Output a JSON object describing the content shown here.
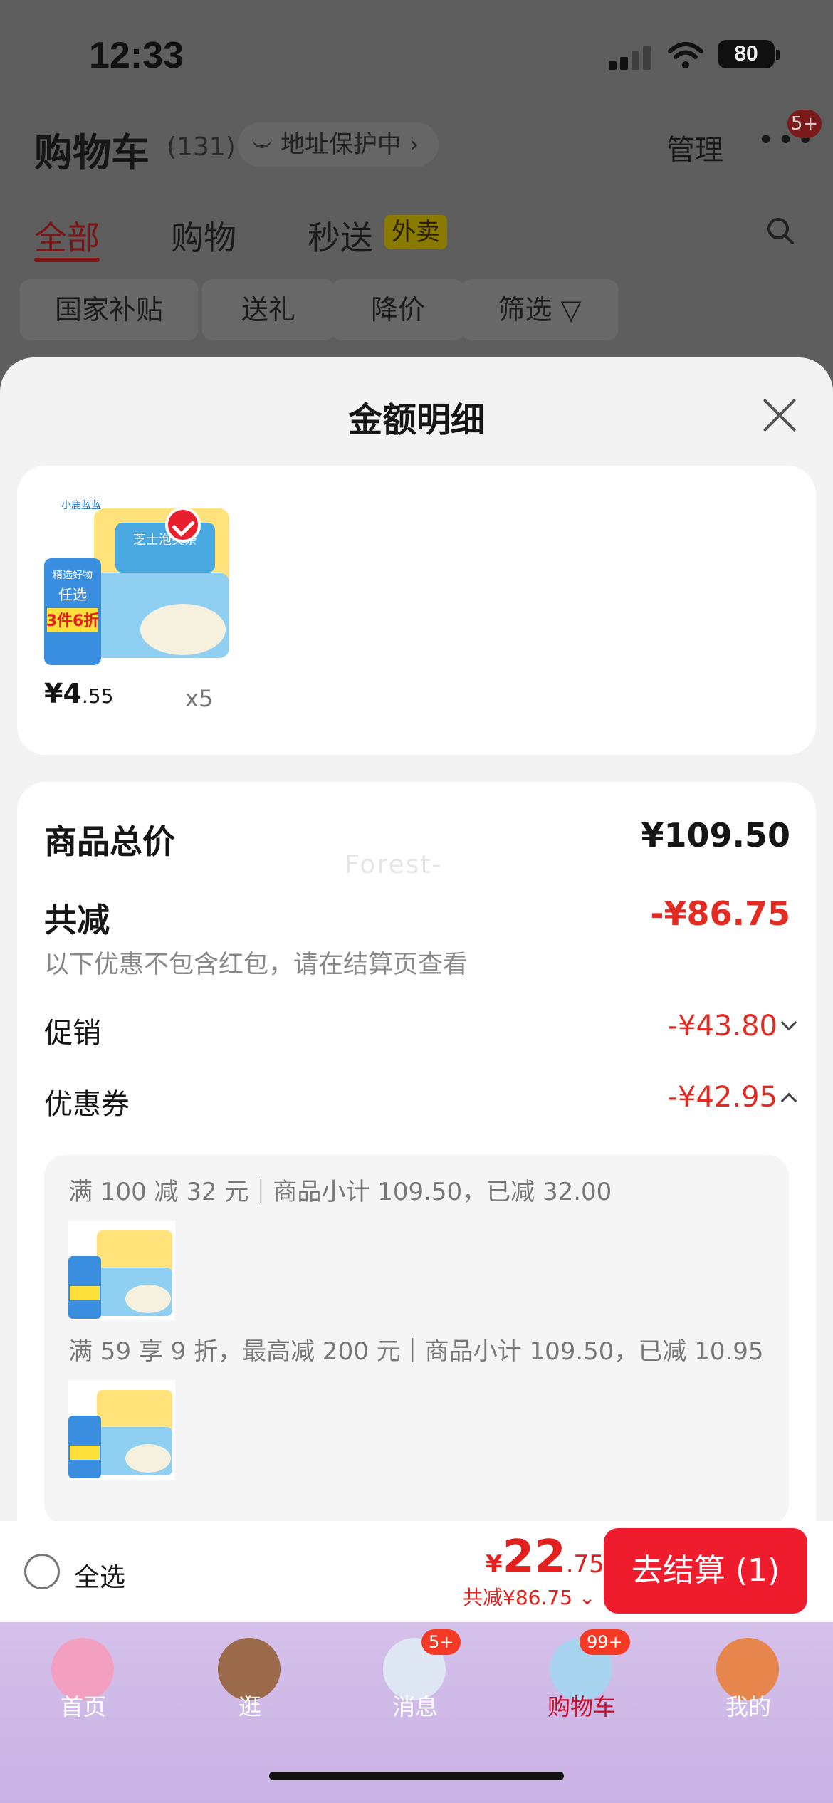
{
  "status_bar": {
    "time": "12:33",
    "battery": "80"
  },
  "cart_header": {
    "title": "购物车",
    "count": "(131)",
    "address_protect": "地址保护中 ›",
    "manage": "管理",
    "more": "•••",
    "more_badge": "5+"
  },
  "tabs": [
    {
      "label": "全部"
    },
    {
      "label": "购物"
    },
    {
      "label": "秒送"
    }
  ],
  "waimai_tag": "外卖",
  "chips": [
    {
      "label": "国家补贴"
    },
    {
      "label": "送礼"
    },
    {
      "label": "降价"
    },
    {
      "label": "筛选"
    }
  ],
  "sheet": {
    "title": "金额明细",
    "product": {
      "price_int": "¥4",
      "price_dec": ".55",
      "qty": "x5",
      "image_text": {
        "tag": "精选好物",
        "line1": "任选",
        "line2": "3件6折",
        "brand": "小鹿蓝蓝",
        "name": "芝士泡芙条"
      }
    },
    "watermark": "Forest-",
    "total_label": "商品总价",
    "total_value": "¥109.50",
    "reduce_label": "共减",
    "reduce_value": "-¥86.75",
    "note": "以下优惠不包含红包，请在结算页查看",
    "promo_label": "促销",
    "promo_value": "-¥43.80",
    "coupon_label": "优惠券",
    "coupon_value": "-¥42.95",
    "coupon_lines": [
      {
        "text": "满 100 减 32 元｜商品小计 109.50，已减 32.00"
      },
      {
        "text": "满 59 享 9 折，最高减 200 元｜商品小计 109.50，已减 10.95"
      }
    ]
  },
  "bottom_bar": {
    "select_all": "全选",
    "price_currency": "¥",
    "price_int": "22",
    "price_dec": ".75",
    "reduce_text": "共减¥86.75",
    "checkout": "去结算 (1)"
  },
  "nav": [
    {
      "label": "首页",
      "color": "#f3a0c0"
    },
    {
      "label": "逛",
      "color": "#9b6a4a"
    },
    {
      "label": "消息",
      "badge": "5+",
      "color": "#dfe7f4"
    },
    {
      "label": "购物车",
      "badge": "99+",
      "color": "#a9d4f0"
    },
    {
      "label": "我的",
      "color": "#e6854c"
    }
  ],
  "colors": {
    "accent_red": "#e22b22",
    "checkout_red": "#ee1c2d",
    "nav_bg": "#d5c1ea"
  }
}
